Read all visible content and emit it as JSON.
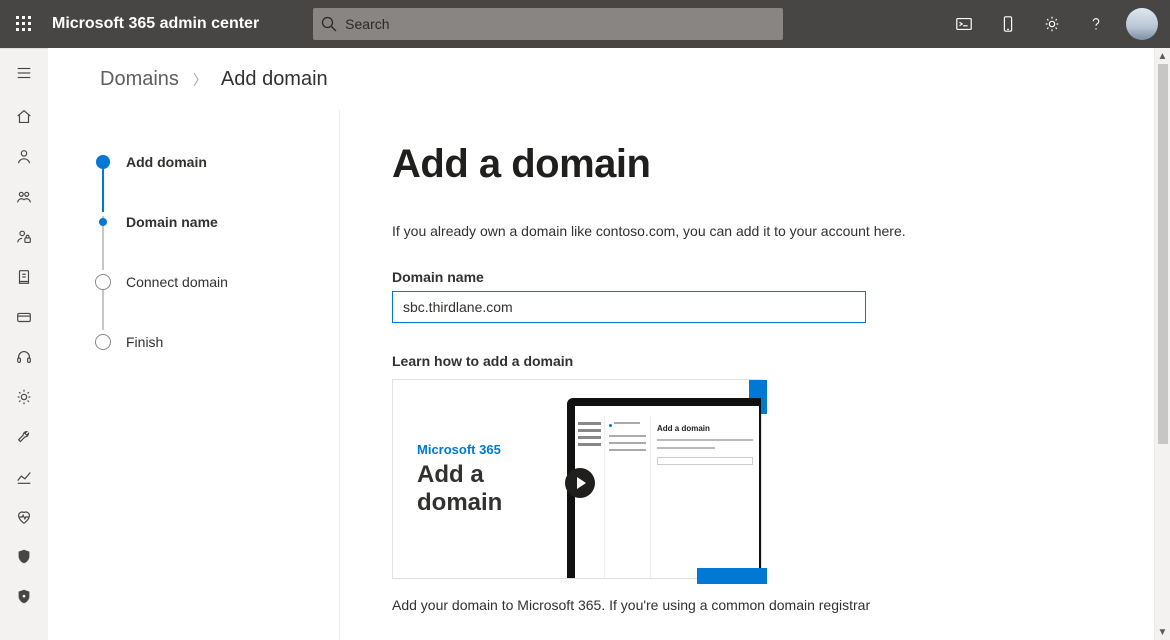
{
  "header": {
    "app_title": "Microsoft 365 admin center",
    "search_placeholder": "Search"
  },
  "breadcrumb": {
    "parent": "Domains",
    "current": "Add domain"
  },
  "wizard": {
    "steps": [
      {
        "label": "Add domain"
      },
      {
        "label": "Domain name"
      },
      {
        "label": "Connect domain"
      },
      {
        "label": "Finish"
      }
    ]
  },
  "main": {
    "heading": "Add a domain",
    "lead": "If you already own a domain like contoso.com, you can add it to your account here.",
    "domain_label": "Domain name",
    "domain_value": "sbc.thirdlane.com",
    "learn_label": "Learn how to add a domain",
    "video_brand": "Microsoft 365",
    "video_title": "Add a domain",
    "video_screen_title": "Add a domain",
    "post_text": "Add your domain to Microsoft 365. If you're using a common domain registrar"
  }
}
